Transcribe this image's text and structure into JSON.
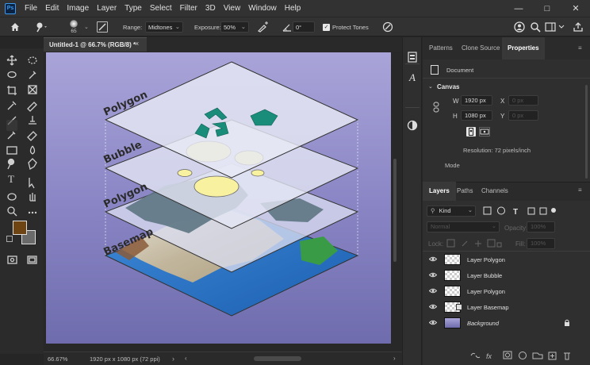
{
  "app": {
    "logo": "Ps"
  },
  "menu": [
    "File",
    "Edit",
    "Image",
    "Layer",
    "Type",
    "Select",
    "Filter",
    "3D",
    "View",
    "Window",
    "Help"
  ],
  "options": {
    "brush_size": "65",
    "range_label": "Range:",
    "range_value": "Midtones",
    "exposure_label": "Exposure:",
    "exposure_value": "50%",
    "angle_value": "0°",
    "protect_tones_label": "Protect Tones"
  },
  "document": {
    "tab_title": "Untitled-1 @ 66.7% (RGB/8) *",
    "zoom": "66.67%",
    "doc_info": "1920 px x 1080 px (72 ppi)"
  },
  "canvas_labels": {
    "layer1": "Polygon",
    "layer2": "Bubble",
    "layer3": "Polygon",
    "layer4": "Basemap"
  },
  "properties_panel": {
    "tabs": [
      "Patterns",
      "Clone Source",
      "Properties"
    ],
    "doc_label": "Document",
    "section": "Canvas",
    "w_label": "W",
    "w_value": "1920 px",
    "h_label": "H",
    "h_value": "1080 px",
    "x_label": "X",
    "x_value": "0 px",
    "y_label": "Y",
    "y_value": "0 px",
    "resolution": "Resolution: 72 pixels/inch",
    "mode_label": "Mode"
  },
  "layers_panel": {
    "tabs": [
      "Layers",
      "Paths",
      "Channels"
    ],
    "filter_value": "Kind",
    "blend_mode": "Normal",
    "opacity_label": "Opacity:",
    "opacity_value": "100%",
    "lock_label": "Lock:",
    "fill_label": "Fill:",
    "fill_value": "100%",
    "layers": [
      {
        "name": "Layer Polygon"
      },
      {
        "name": "Layer Bubble"
      },
      {
        "name": "Layer Polygon"
      },
      {
        "name": "Layer Basemap"
      },
      {
        "name": "Background"
      }
    ]
  }
}
